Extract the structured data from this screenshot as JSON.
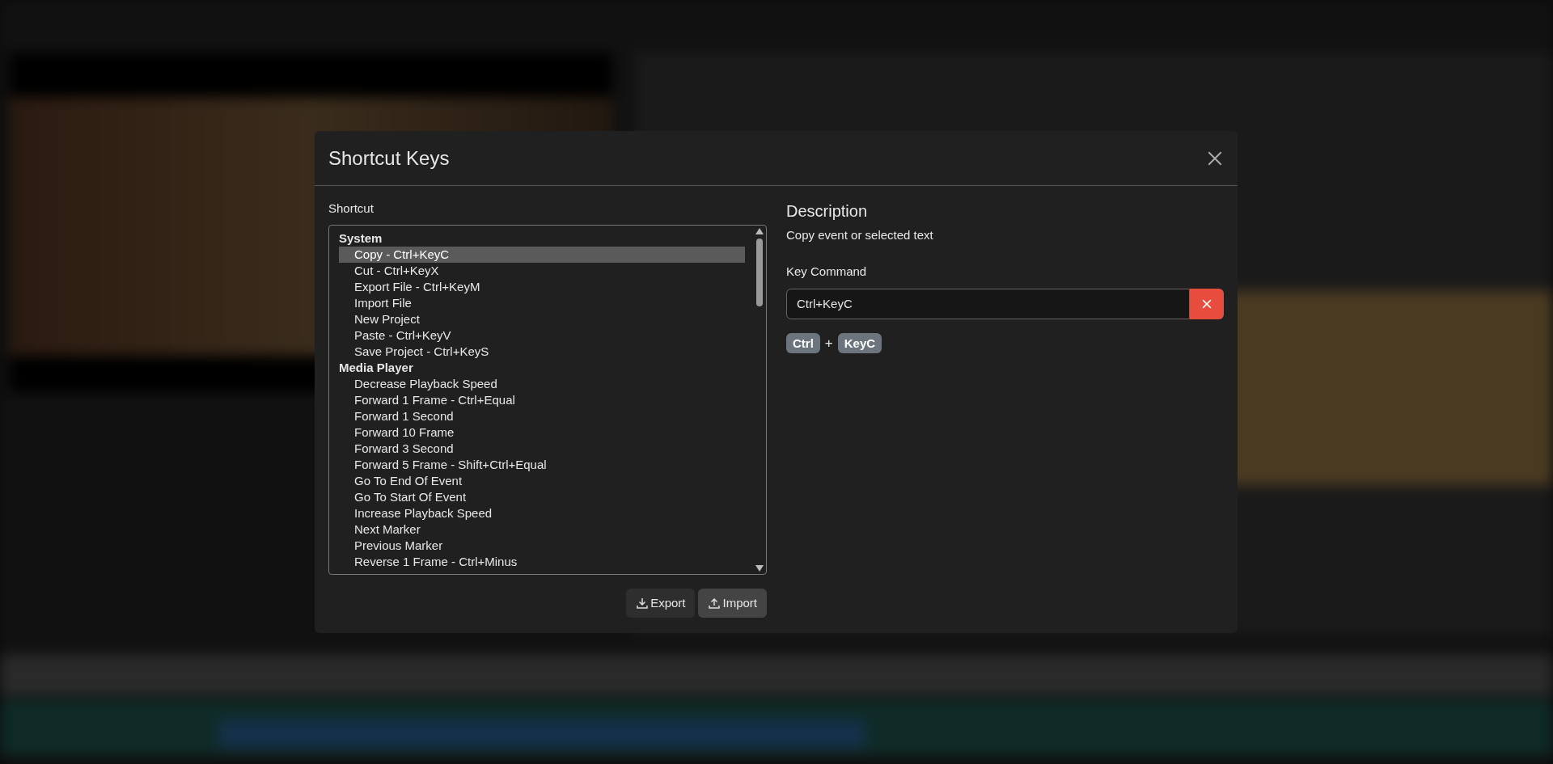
{
  "dialog": {
    "title": "Shortcut Keys",
    "shortcut_label": "Shortcut",
    "groups": [
      {
        "label": "System",
        "items": [
          {
            "label": "Copy - Ctrl+KeyC",
            "selected": true
          },
          {
            "label": "Cut - Ctrl+KeyX",
            "selected": false
          },
          {
            "label": "Export File - Ctrl+KeyM",
            "selected": false
          },
          {
            "label": "Import File",
            "selected": false
          },
          {
            "label": "New Project",
            "selected": false
          },
          {
            "label": "Paste - Ctrl+KeyV",
            "selected": false
          },
          {
            "label": "Save Project - Ctrl+KeyS",
            "selected": false
          }
        ]
      },
      {
        "label": "Media Player",
        "items": [
          {
            "label": "Decrease Playback Speed",
            "selected": false
          },
          {
            "label": "Forward 1 Frame - Ctrl+Equal",
            "selected": false
          },
          {
            "label": "Forward 1 Second",
            "selected": false
          },
          {
            "label": "Forward 10 Frame",
            "selected": false
          },
          {
            "label": "Forward 3 Second",
            "selected": false
          },
          {
            "label": "Forward 5 Frame - Shift+Ctrl+Equal",
            "selected": false
          },
          {
            "label": "Go To End Of Event",
            "selected": false
          },
          {
            "label": "Go To Start Of Event",
            "selected": false
          },
          {
            "label": "Increase Playback Speed",
            "selected": false
          },
          {
            "label": "Next Marker",
            "selected": false
          },
          {
            "label": "Previous Marker",
            "selected": false
          },
          {
            "label": "Reverse 1 Frame - Ctrl+Minus",
            "selected": false
          }
        ]
      }
    ],
    "description_heading": "Description",
    "description": "Copy event or selected text",
    "key_command_label": "Key Command",
    "key_command_value": "Ctrl+KeyC",
    "key_chips": [
      {
        "kind": "key",
        "label": "Ctrl"
      },
      {
        "kind": "plus",
        "label": "+"
      },
      {
        "kind": "key",
        "label": "KeyC"
      }
    ],
    "buttons": [
      {
        "kind": "export",
        "label": "Export"
      },
      {
        "kind": "import",
        "label": "Import"
      }
    ]
  }
}
